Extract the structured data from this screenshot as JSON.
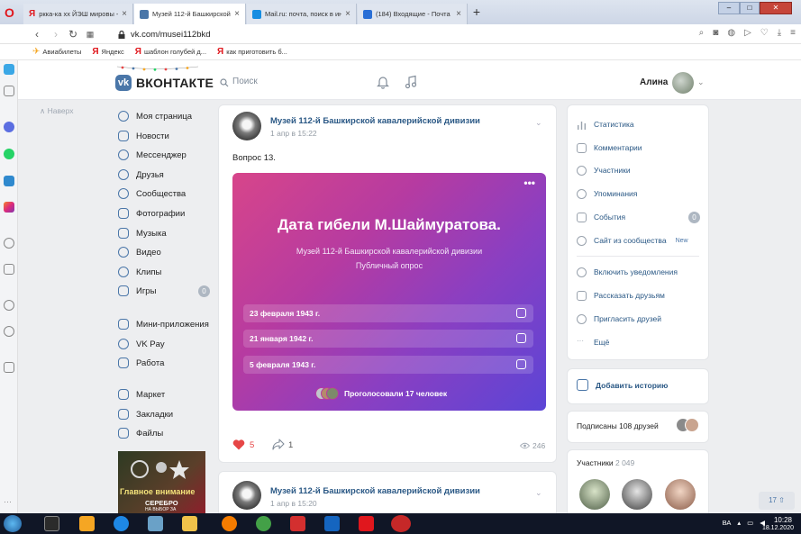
{
  "browser": {
    "tabs": [
      {
        "label": "ркка-ка хх ЙЭШ мировы -"
      },
      {
        "label": "Музей 112-й Башкирской"
      },
      {
        "label": "Mail.ru: почта, поиск в ин"
      },
      {
        "label": "(184) Входящие - Почта М"
      }
    ],
    "url": "vk.com/musei112bkd",
    "bookmarks": [
      {
        "label": "Авиабилеты"
      },
      {
        "label": "Яндекс"
      },
      {
        "label": "шаблон голубей д..."
      },
      {
        "label": "как приготовить б..."
      }
    ]
  },
  "vk": {
    "logo_text": "ВКОНТАКТЕ",
    "search_placeholder": "Поиск",
    "username": "Алина"
  },
  "left_menu": {
    "back_top": "Наверх",
    "items": [
      {
        "label": "Моя страница",
        "icon": "user-circle-icon"
      },
      {
        "label": "Новости",
        "icon": "news-icon"
      },
      {
        "label": "Мессенджер",
        "icon": "message-icon"
      },
      {
        "label": "Друзья",
        "icon": "friends-icon"
      },
      {
        "label": "Сообщества",
        "icon": "groups-icon"
      },
      {
        "label": "Фотографии",
        "icon": "photo-icon"
      },
      {
        "label": "Музыка",
        "icon": "music-icon"
      },
      {
        "label": "Видео",
        "icon": "video-icon"
      },
      {
        "label": "Клипы",
        "icon": "clips-icon"
      },
      {
        "label": "Игры",
        "icon": "games-icon",
        "count": "0"
      },
      {
        "label": "Мини-приложения",
        "icon": "apps-icon"
      },
      {
        "label": "VK Pay",
        "icon": "vkpay-icon"
      },
      {
        "label": "Работа",
        "icon": "work-icon"
      },
      {
        "label": "Маркет",
        "icon": "market-icon"
      },
      {
        "label": "Закладки",
        "icon": "star-icon"
      },
      {
        "label": "Файлы",
        "icon": "file-icon"
      }
    ],
    "ad": {
      "title": "Главное внимание",
      "sub": "СЕРЕБРО",
      "sub2": "НА ВЫБОР ЗА"
    }
  },
  "post1": {
    "author": "Музей 112-й Башкирской кавалерийской дивизии",
    "date": "1 апр в 15:22",
    "text": "Вопрос 13.",
    "poll": {
      "question": "Дата гибели М.Шаймуратова.",
      "author": "Музей 112-й Башкирской кавалерийской дивизии",
      "type": "Публичный опрос",
      "options": [
        "23 февраля 1943 г.",
        "21 января 1942 г.",
        "5 февраля 1943 г."
      ],
      "voters": "Проголосовали 17 человек"
    },
    "likes": "5",
    "shares": "1",
    "views": "246"
  },
  "post2": {
    "author": "Музей 112-й Башкирской кавалерийской дивизии",
    "date": "1 апр в 15:20"
  },
  "right_menu": {
    "items": [
      {
        "label": "Статистика",
        "icon": "stats-icon"
      },
      {
        "label": "Комментарии",
        "icon": "comment-icon"
      },
      {
        "label": "Участники",
        "icon": "user-icon"
      },
      {
        "label": "Упоминания",
        "icon": "mention-icon"
      },
      {
        "label": "События",
        "icon": "events-icon",
        "count": "0"
      },
      {
        "label": "Сайт из сообщества",
        "icon": "globe-icon",
        "tag": "New"
      },
      {
        "label": "Включить уведомления",
        "icon": "bell-icon"
      },
      {
        "label": "Рассказать друзьям",
        "icon": "share-icon"
      },
      {
        "label": "Пригласить друзей",
        "icon": "invite-icon"
      },
      {
        "label": "Ещё",
        "icon": "more-icon"
      }
    ],
    "story": "Добавить историю",
    "friends": "Подписаны 108 друзей",
    "members_label": "Участники",
    "members_count": "2 049"
  },
  "scroll_counter": "17",
  "taskbar": {
    "lang": "ВА",
    "time": "10:28",
    "date": "18.12.2020"
  },
  "colors": {
    "vk_blue": "#4a76a8",
    "link": "#2a5885",
    "like_red": "#e64646",
    "poll_start": "#d7458a",
    "poll_end": "#5b45d6"
  }
}
